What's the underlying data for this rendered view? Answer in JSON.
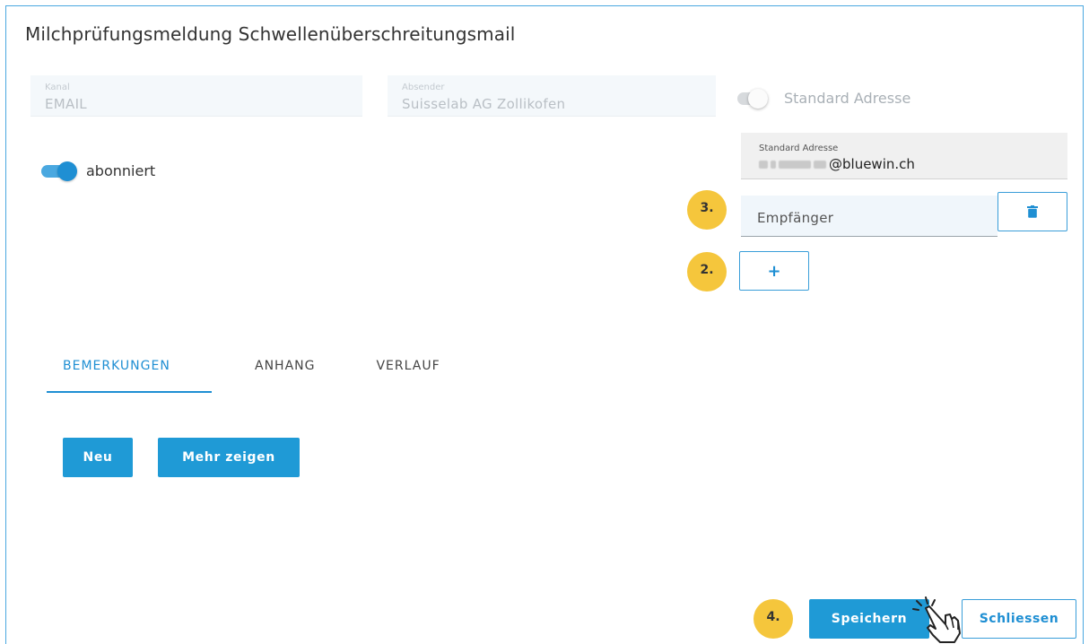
{
  "dialog": {
    "title": "Milchprüfungsmeldung Schwellenüberschreitungsmail"
  },
  "fields": {
    "kanal": {
      "label": "Kanal",
      "value": "EMAIL"
    },
    "absender": {
      "label": "Absender",
      "value": "Suisselab AG Zollikofen"
    }
  },
  "toggles": {
    "abonniert": {
      "label": "abonniert",
      "state": "on"
    },
    "standard_adresse": {
      "label": "Standard Adresse",
      "state": "off"
    }
  },
  "standard_address_field": {
    "label": "Standard Adresse",
    "value_visible": "@bluewin.ch"
  },
  "recipient": {
    "placeholder": "Empfänger"
  },
  "buttons": {
    "add": "+",
    "neu": "Neu",
    "mehr_zeigen": "Mehr zeigen",
    "speichern": "Speichern",
    "schliessen": "Schliessen"
  },
  "tabs": [
    {
      "label": "BEMERKUNGEN",
      "active": true
    },
    {
      "label": "ANHANG",
      "active": false
    },
    {
      "label": "VERLAUF",
      "active": false
    }
  ],
  "step_badges": {
    "step3": "3.",
    "step2": "2.",
    "step4": "4."
  },
  "icons": {
    "delete": "trash-icon",
    "cursor": "hand-pointer-icon"
  },
  "colors": {
    "accent": "#1f9ad6",
    "badge": "#f5c63c",
    "disabled_bg": "#f4f8fb"
  }
}
